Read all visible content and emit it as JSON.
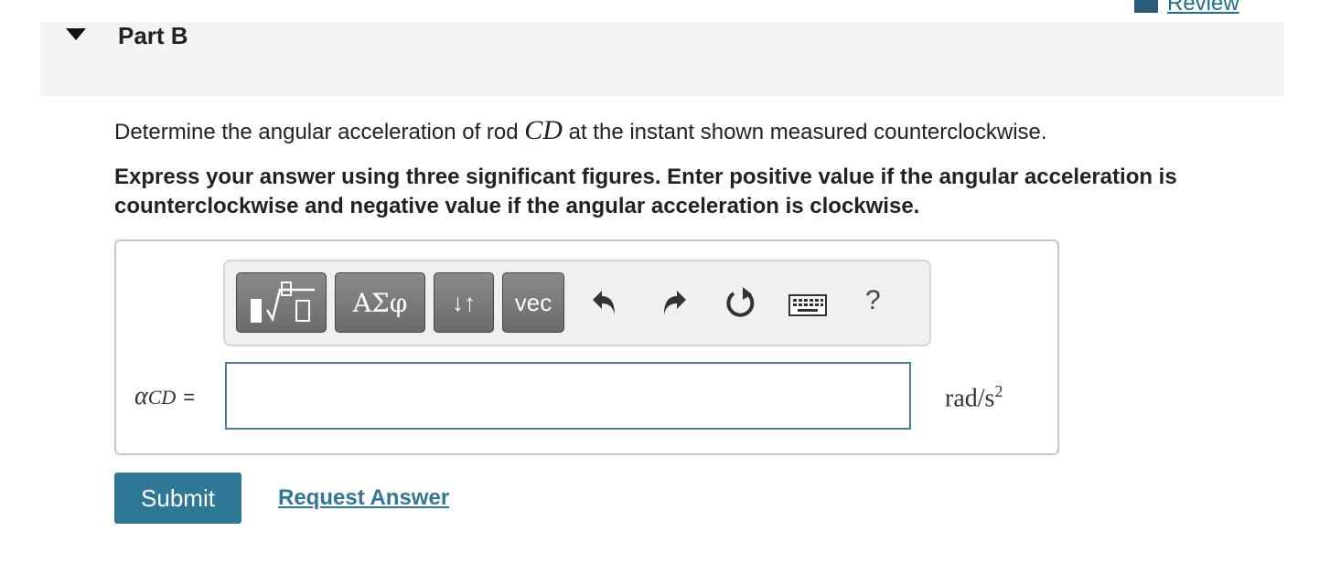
{
  "header": {
    "review_label": "Review",
    "part_title": "Part B"
  },
  "question": {
    "text_before": "Determine the angular acceleration of rod ",
    "variable": "CD",
    "text_after": " at the instant shown measured counterclockwise.",
    "instructions": "Express your answer using three significant figures. Enter positive value if the angular acceleration is counterclockwise and negative value if the angular acceleration is clockwise."
  },
  "toolbar": {
    "symbols_label": "ΑΣφ",
    "arrows_label": "↓↑",
    "vec_label": "vec",
    "help_label": "?",
    "icons": [
      "templates-icon",
      "undo-icon",
      "redo-icon",
      "reset-icon",
      "keyboard-icon"
    ]
  },
  "answer": {
    "var_main": "α",
    "var_sub": "CD",
    "equals": "=",
    "value": "",
    "units_main": "rad/s",
    "units_exp": "2"
  },
  "actions": {
    "submit_label": "Submit",
    "request_label": "Request Answer"
  }
}
